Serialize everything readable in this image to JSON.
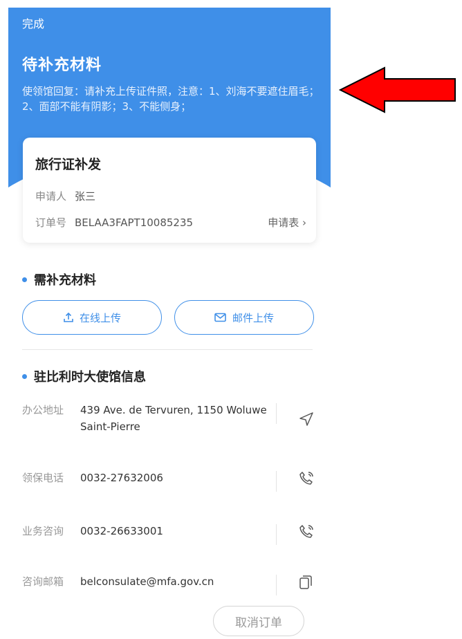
{
  "header": {
    "done_label": "完成",
    "status_title": "待补充材料",
    "status_message": "使领馆回复：请补充上传证件照，注意：1、刘海不要遮住眉毛；2、面部不能有阴影；3、不能侧身；",
    "bg_color": "#3f8fe8"
  },
  "order_card": {
    "title": "旅行证补发",
    "applicant_label": "申请人",
    "applicant_value": "张三",
    "order_no_label": "订单号",
    "order_no_value": "BELAA3FAPT10085235",
    "form_link": "申请表 ›"
  },
  "materials": {
    "heading": "需补充材料",
    "online_upload": "在线上传",
    "mail_upload": "邮件上传",
    "accent_color": "#3f8fe8"
  },
  "embassy": {
    "heading": "驻比利时大使馆信息",
    "rows": [
      {
        "label": "办公地址",
        "value": "439 Ave. de Tervuren, 1150 Woluwe Saint-Pierre",
        "icon": "navigate-icon"
      },
      {
        "label": "领保电话",
        "value": "0032-27632006",
        "icon": "phone-icon"
      },
      {
        "label": "业务咨询",
        "value": "0032-26633001",
        "icon": "phone-icon"
      },
      {
        "label": "咨询邮箱",
        "value": "belconsulate@mfa.gov.cn",
        "icon": "copy-icon"
      }
    ]
  },
  "footer": {
    "cancel_label": "取消订单"
  },
  "annotation": {
    "arrow_color": "#ff0000"
  }
}
